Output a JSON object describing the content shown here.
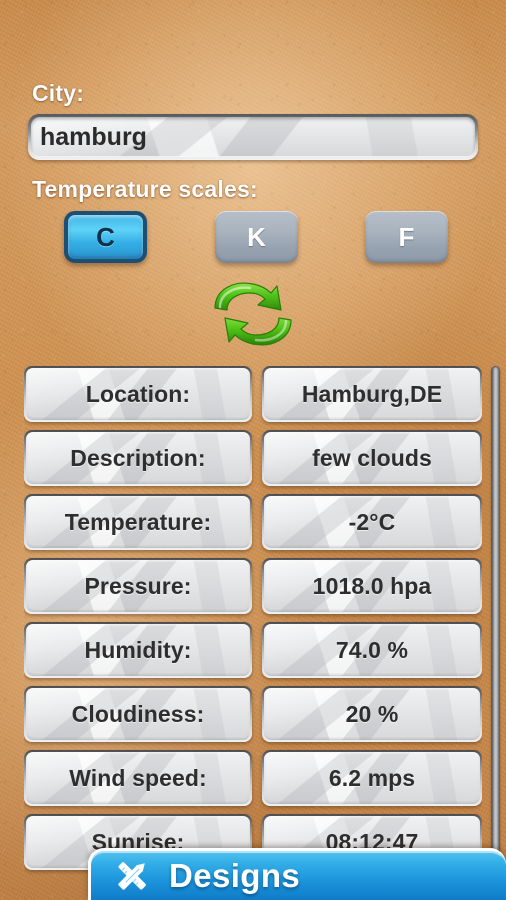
{
  "form": {
    "city_label": "City:",
    "city_value": "hamburg",
    "city_placeholder": "",
    "scales_label": "Temperature scales:"
  },
  "scales": {
    "options": [
      {
        "id": "c",
        "label": "C",
        "selected": true
      },
      {
        "id": "k",
        "label": "K",
        "selected": false
      },
      {
        "id": "f",
        "label": "F",
        "selected": false
      }
    ]
  },
  "actions": {
    "refresh_icon": "refresh-sync-icon"
  },
  "weather": {
    "rows": [
      {
        "label": "Location:",
        "value": "Hamburg,DE"
      },
      {
        "label": "Description:",
        "value": "few clouds"
      },
      {
        "label": "Temperature:",
        "value": "-2°C"
      },
      {
        "label": "Pressure:",
        "value": "1018.0 hpa"
      },
      {
        "label": "Humidity:",
        "value": "74.0 %"
      },
      {
        "label": "Cloudiness:",
        "value": "20 %"
      },
      {
        "label": "Wind speed:",
        "value": "6.2 mps"
      },
      {
        "label": "Sunrise:",
        "value": "08:12:47"
      }
    ]
  },
  "banner": {
    "title": "Designs",
    "icon": "pencil-ruler-icon"
  },
  "colors": {
    "background": "#cf924f",
    "accent_blue": "#35b0e9",
    "selected_button": "#3fb6e8",
    "selected_button_border": "#1d4f74",
    "inactive_button": "#a9b3be",
    "refresh_green": "#4ec31e",
    "text_light": "#ffffff",
    "text_dark": "#2e2e2e"
  }
}
